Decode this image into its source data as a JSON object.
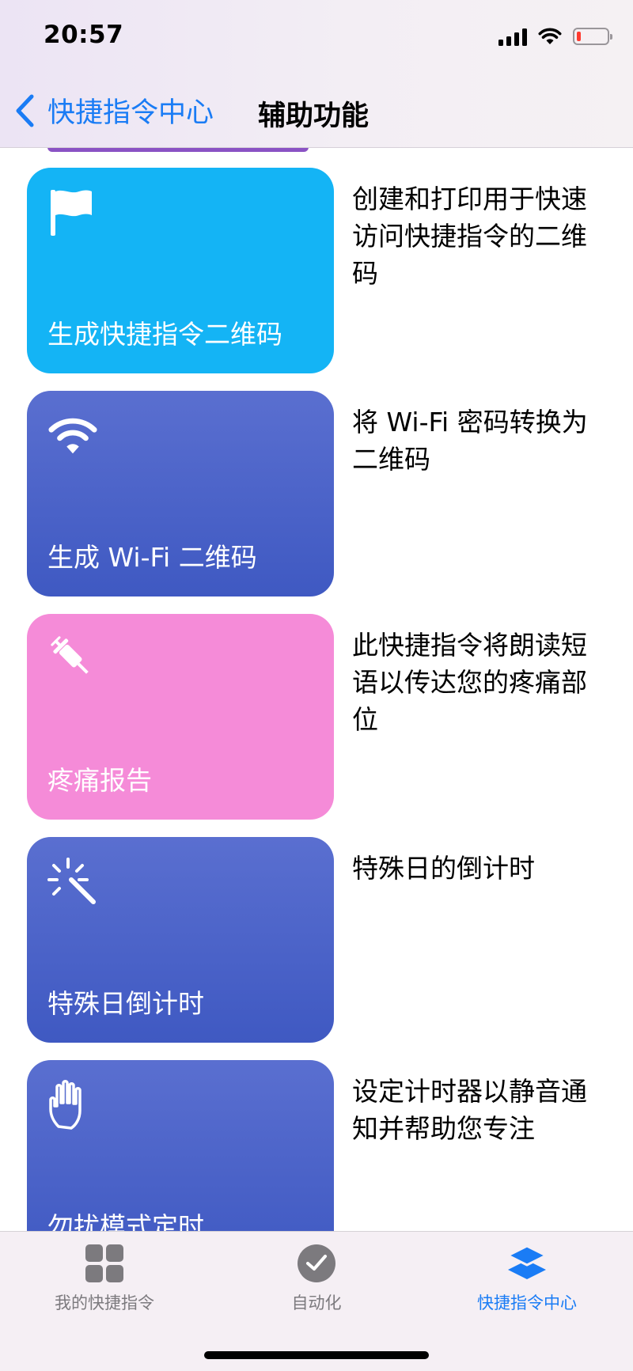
{
  "status_bar": {
    "time": "20:57",
    "battery_level": 0.15
  },
  "nav": {
    "back_label": "快捷指令中心",
    "title": "辅助功能"
  },
  "shortcuts": [
    {
      "title": "生成快捷指令二维码",
      "description": "创建和打印用于快速访问快捷指令的二维码",
      "icon": "flag-icon",
      "color": "#14b4f5"
    },
    {
      "title": "生成 Wi-Fi 二维码",
      "description": "将 Wi-Fi 密码转换为二维码",
      "icon": "wifi-icon",
      "color": "#4a63c9"
    },
    {
      "title": "疼痛报告",
      "description": "此快捷指令将朗读短语以传达您的疼痛部位",
      "icon": "syringe-icon",
      "color": "#f58bd8"
    },
    {
      "title": "特殊日倒计时",
      "description": "特殊日的倒计时",
      "icon": "magic-wand-icon",
      "color": "#4a63c9"
    },
    {
      "title": "勿扰模式定时",
      "description": "设定计时器以静音通知并帮助您专注",
      "icon": "hand-icon",
      "color": "#4a63c9"
    }
  ],
  "tabs": [
    {
      "label": "我的快捷指令",
      "icon": "grid-icon",
      "active": false
    },
    {
      "label": "自动化",
      "icon": "clock-check-icon",
      "active": false
    },
    {
      "label": "快捷指令中心",
      "icon": "layers-icon",
      "active": true
    }
  ],
  "colors": {
    "accent": "#1a7cf5",
    "inactive_tab": "#7c7a7e",
    "header_bg": "#efe8f3"
  }
}
